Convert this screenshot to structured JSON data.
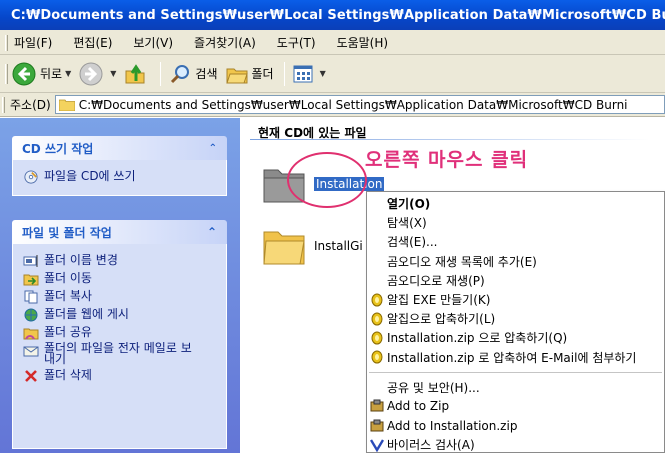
{
  "window": {
    "title": "C:₩Documents and Settings₩user₩Local Settings₩Application Data₩Microsoft₩CD Bu"
  },
  "menubar": {
    "items": [
      "파일(F)",
      "편집(E)",
      "보기(V)",
      "즐겨찾기(A)",
      "도구(T)",
      "도움말(H)"
    ]
  },
  "toolbar": {
    "back": "뒤로",
    "search": "검색",
    "folders": "폴더"
  },
  "address": {
    "label": "주소(D)",
    "value": "C:₩Documents and Settings₩user₩Local Settings₩Application Data₩Microsoft₩CD Burni"
  },
  "leftpane": {
    "cd_panel": {
      "title": "CD 쓰기 작업",
      "items": [
        "파일을 CD에 쓰기"
      ]
    },
    "file_panel": {
      "title": "파일 및 폴더 작업",
      "items": [
        "폴더 이름 변경",
        "폴더 이동",
        "폴더 복사",
        "폴더를 웹에 게시",
        "폴더 공유",
        "폴더의 파일을 전자 메일로 보내기",
        "폴더 삭제"
      ]
    }
  },
  "content": {
    "section_title": "현재 CD에 있는 파일",
    "files": [
      "Installation",
      "InstallGi"
    ]
  },
  "annotation": "오른쪽 마우스 클릭",
  "context_menu": {
    "items": [
      {
        "label": "열기(O)",
        "bold": true
      },
      {
        "label": "탐색(X)"
      },
      {
        "label": "검색(E)..."
      },
      {
        "label": "곰오디오 재생 목록에 추가(E)"
      },
      {
        "label": "곰오디오로 재생(P)"
      },
      {
        "label": "알집 EXE 만들기(K)",
        "icon": "alzip-icon"
      },
      {
        "label": "알집으로 압축하기(L)",
        "icon": "alzip-icon"
      },
      {
        "label": "Installation.zip 으로 압축하기(Q)",
        "icon": "alzip-icon"
      },
      {
        "label": "Installation.zip 로 압축하여 E-Mail에 첨부하기",
        "icon": "alzip-icon"
      },
      {
        "label": "공유 및 보안(H)..."
      },
      {
        "label": "Add to Zip",
        "icon": "winzip-icon"
      },
      {
        "label": "Add to Installation.zip",
        "icon": "winzip-icon"
      },
      {
        "label": "바이러스 검사(A)",
        "icon": "antivirus-icon"
      }
    ]
  },
  "colors": {
    "title_bar": "#0646c9",
    "task_pane": "#6f8ddc",
    "selection": "#316ac5",
    "annotation": "#e0307a"
  }
}
